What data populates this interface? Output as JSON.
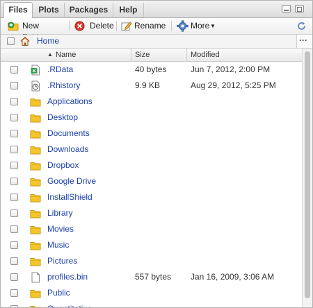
{
  "tabs": [
    {
      "label": "Files",
      "active": true
    },
    {
      "label": "Plots",
      "active": false
    },
    {
      "label": "Packages",
      "active": false
    },
    {
      "label": "Help",
      "active": false
    }
  ],
  "toolbar": {
    "new_folder": "New Folder",
    "delete": "Delete",
    "rename": "Rename",
    "more": "More"
  },
  "breadcrumb": {
    "home": "Home",
    "more_glyph": "···"
  },
  "columns": {
    "name": "Name",
    "size": "Size",
    "modified": "Modified",
    "sort_indicator": "▲"
  },
  "files": [
    {
      "name": ".RData",
      "icon": "rdata-file-icon",
      "size": "40 bytes",
      "modified": "Jun 7, 2012, 2:00 PM"
    },
    {
      "name": ".Rhistory",
      "icon": "history-file-icon",
      "size": "9.9 KB",
      "modified": "Aug 29, 2012, 5:25 PM"
    },
    {
      "name": "Applications",
      "icon": "folder-icon",
      "size": "",
      "modified": ""
    },
    {
      "name": "Desktop",
      "icon": "folder-icon",
      "size": "",
      "modified": ""
    },
    {
      "name": "Documents",
      "icon": "folder-icon",
      "size": "",
      "modified": ""
    },
    {
      "name": "Downloads",
      "icon": "folder-icon",
      "size": "",
      "modified": ""
    },
    {
      "name": "Dropbox",
      "icon": "folder-icon",
      "size": "",
      "modified": ""
    },
    {
      "name": "Google Drive",
      "icon": "folder-icon",
      "size": "",
      "modified": ""
    },
    {
      "name": "InstallShield",
      "icon": "folder-icon",
      "size": "",
      "modified": ""
    },
    {
      "name": "Library",
      "icon": "folder-icon",
      "size": "",
      "modified": ""
    },
    {
      "name": "Movies",
      "icon": "folder-icon",
      "size": "",
      "modified": ""
    },
    {
      "name": "Music",
      "icon": "folder-icon",
      "size": "",
      "modified": ""
    },
    {
      "name": "Pictures",
      "icon": "folder-icon",
      "size": "",
      "modified": ""
    },
    {
      "name": "profiles.bin",
      "icon": "document-file-icon",
      "size": "557 bytes",
      "modified": "Jan 16, 2009, 3:06 AM"
    },
    {
      "name": "Public",
      "icon": "folder-icon",
      "size": "",
      "modified": ""
    },
    {
      "name": "Quantitative",
      "icon": "folder-icon",
      "size": "",
      "modified": ""
    }
  ],
  "colors": {
    "link": "#1a3fa8",
    "folder": "#f3c62b",
    "folder_edge": "#c99a10",
    "rdata_green": "#2e9d4a"
  }
}
